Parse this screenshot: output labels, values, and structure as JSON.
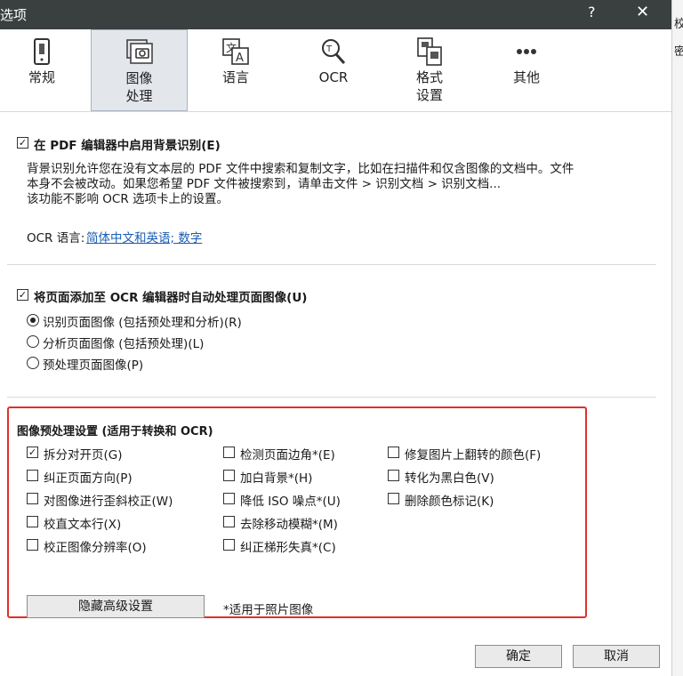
{
  "window": {
    "title": "选项",
    "help": "?",
    "close": "✕"
  },
  "background_fragment": [
    "校",
    "密"
  ],
  "tabs": [
    {
      "label_1": "常规",
      "label_2": "",
      "icon": "switch-icon"
    },
    {
      "label_1": "图像",
      "label_2": "处理",
      "icon": "image-processing-icon"
    },
    {
      "label_1": "语言",
      "label_2": "",
      "icon": "language-icon"
    },
    {
      "label_1": "OCR",
      "label_2": "",
      "icon": "ocr-magnifier-icon"
    },
    {
      "label_1": "格式",
      "label_2": "设置",
      "icon": "format-icon"
    },
    {
      "label_1": "其他",
      "label_2": "",
      "icon": "more-icon"
    }
  ],
  "section1": {
    "checkbox_label": "在 PDF 编辑器中启用背景识别(E)",
    "checked": true,
    "desc_line1": "背景识别允许您在没有文本层的 PDF 文件中搜索和复制文字，比如在扫描件和仅含图像的文档中。文件",
    "desc_line2": "本身不会被改动。如果您希望 PDF 文件被搜索到，请单击文件 > 识别文档 > 识别文档...",
    "desc_line3": "该功能不影响 OCR 选项卡上的设置。",
    "ocr_lang_label": "OCR 语言:",
    "ocr_lang_value": "简体中文和英语; 数字"
  },
  "section2": {
    "checkbox_label": "将页面添加至 OCR 编辑器时自动处理页面图像(U)",
    "checked": true,
    "radios": [
      {
        "label": "识别页面图像 (包括预处理和分析)(R)",
        "selected": true
      },
      {
        "label": "分析页面图像 (包括预处理)(L)",
        "selected": false
      },
      {
        "label": "预处理页面图像(P)",
        "selected": false
      }
    ]
  },
  "section3": {
    "title": "图像预处理设置 (适用于转换和 OCR)",
    "col1": [
      {
        "label": "拆分对开页(G)",
        "checked": true
      },
      {
        "label": "纠正页面方向(P)",
        "checked": false
      },
      {
        "label": "对图像进行歪斜校正(W)",
        "checked": false
      },
      {
        "label": "校直文本行(X)",
        "checked": false
      },
      {
        "label": "校正图像分辨率(O)",
        "checked": false
      }
    ],
    "col2": [
      {
        "label": "检测页面边角*(E)",
        "checked": false
      },
      {
        "label": "加白背景*(H)",
        "checked": false
      },
      {
        "label": "降低 ISO 噪点*(U)",
        "checked": false
      },
      {
        "label": "去除移动模糊*(M)",
        "checked": false
      },
      {
        "label": "纠正梯形失真*(C)",
        "checked": false
      }
    ],
    "col3": [
      {
        "label": "修复图片上翻转的颜色(F)",
        "checked": false
      },
      {
        "label": "转化为黑白色(V)",
        "checked": false
      },
      {
        "label": "删除颜色标记(K)",
        "checked": false
      }
    ],
    "hide_button": "隐藏高级设置",
    "note": "*适用于照片图像"
  },
  "footer": {
    "ok": "确定",
    "cancel": "取消"
  },
  "colors": {
    "titlebar": "#3a3f3f",
    "highlight": "#e0302a",
    "link": "#1a5fb4"
  }
}
